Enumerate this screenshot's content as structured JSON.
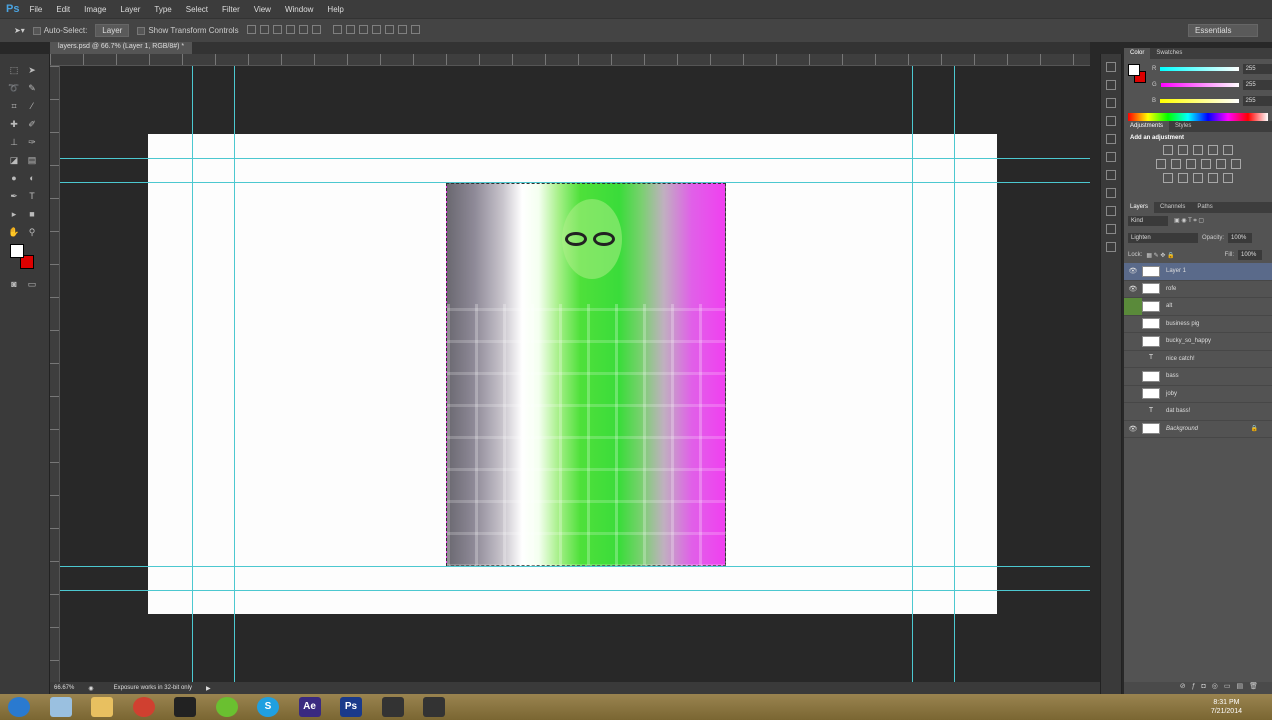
{
  "app": {
    "logo": "Ps"
  },
  "menu": [
    "File",
    "Edit",
    "Image",
    "Layer",
    "Type",
    "Select",
    "Filter",
    "View",
    "Window",
    "Help"
  ],
  "options": {
    "auto_select": "Auto-Select:",
    "auto_select_target": "Layer",
    "show_transform": "Show Transform Controls",
    "workspace": "Essentials"
  },
  "document_tab": "layers.psd @ 66.7% (Layer 1, RGB/8#) *",
  "color_panel": {
    "tabs": [
      "Color",
      "Swatches"
    ],
    "r": "255",
    "g": "255",
    "b": "255",
    "foreground": "#ffffff",
    "background": "#dd0000"
  },
  "adjustments_panel": {
    "tabs": [
      "Adjustments",
      "Styles"
    ],
    "heading": "Add an adjustment"
  },
  "layers_panel": {
    "tabs": [
      "Layers",
      "Channels",
      "Paths"
    ],
    "filter": "Kind",
    "blend_mode": "Lighten",
    "opacity_label": "Opacity:",
    "opacity": "100%",
    "lock_label": "Lock:",
    "fill_label": "Fill:",
    "fill": "100%",
    "layers": [
      {
        "name": "Layer 1",
        "visible": true,
        "selected": true,
        "type": "image"
      },
      {
        "name": "rofe",
        "visible": true,
        "type": "image"
      },
      {
        "name": "alt",
        "visible": false,
        "type": "image"
      },
      {
        "name": "business pig",
        "visible": false,
        "type": "image"
      },
      {
        "name": "bucky_so_happy",
        "visible": false,
        "type": "image"
      },
      {
        "name": "nice catch!",
        "visible": false,
        "type": "text"
      },
      {
        "name": "bass",
        "visible": false,
        "type": "image"
      },
      {
        "name": "joby",
        "visible": false,
        "type": "image"
      },
      {
        "name": "dat bass!",
        "visible": false,
        "type": "text"
      },
      {
        "name": "Background",
        "visible": true,
        "type": "background",
        "locked": true
      }
    ]
  },
  "status": {
    "zoom": "66.67%",
    "message": "Exposure works in 32-bit only"
  },
  "taskbar": {
    "apps": [
      "start",
      "file-manager",
      "explorer",
      "chrome",
      "steam",
      "spotify",
      "skype",
      "after-effects",
      "photoshop",
      "app-1",
      "app-2"
    ],
    "labels": {
      "skype": "S",
      "after-effects": "Ae",
      "photoshop": "Ps"
    },
    "time": "8:31 PM",
    "date": "7/21/2014"
  }
}
